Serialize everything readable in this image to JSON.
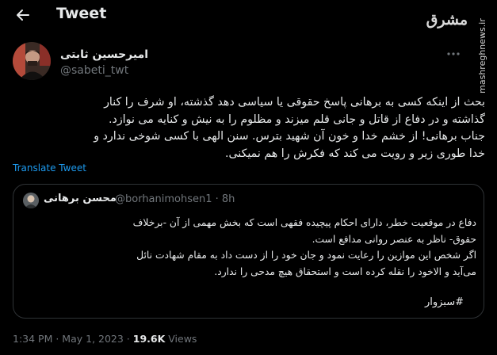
{
  "header": {
    "title": "Tweet",
    "back_icon": "arrow-left-icon"
  },
  "watermark": {
    "logo": "مشرق",
    "url": "mashreghnews.ir"
  },
  "author": {
    "name": "امیرحسین ثابتی",
    "handle": "@sabeti_twt",
    "more_icon": "more-horizontal-icon"
  },
  "tweet": {
    "lines": [
      "بحث از اینکه کسی به برهانی پاسخ حقوقی یا سیاسی دهد گذشته، او شرف را کنار",
      "گذاشته و در دفاع از قاتل و جانی قلم میزند و مظلوم را به نیش و کنایه می نوازد.",
      "جناب برهانی! از خشم خدا و خون آن شهید بترس. سنن الهی با کسی شوخی ندارد و",
      "خدا طوری زیر و رویت می کند که فکرش را هم نمیکنی."
    ],
    "translate_label": "Translate Tweet"
  },
  "quote": {
    "name": "محسن برهانی",
    "handle": "@borhanimohsen1 · 8h",
    "lines": [
      "دفاع در موقعیت خطر، دارای احکام پیچیده فقهی است که بخش مهمی از آن -برخلاف",
      "حقوق- ناظر به عنصر روانی مدافع است.",
      "اگر شخص این موازین را رعایت نمود و جان خود را از دست داد به مقام شهادت نائل",
      "می‌آید و الاخود را نقله کرده است و استحقاق هیچ مدحی را ندارد."
    ],
    "hashtag": "#سبزوار"
  },
  "meta": {
    "time": "1:34 PM",
    "separator": " · ",
    "date": "May 1, 2023",
    "views_count": "19.6K",
    "views_label": "Views"
  }
}
